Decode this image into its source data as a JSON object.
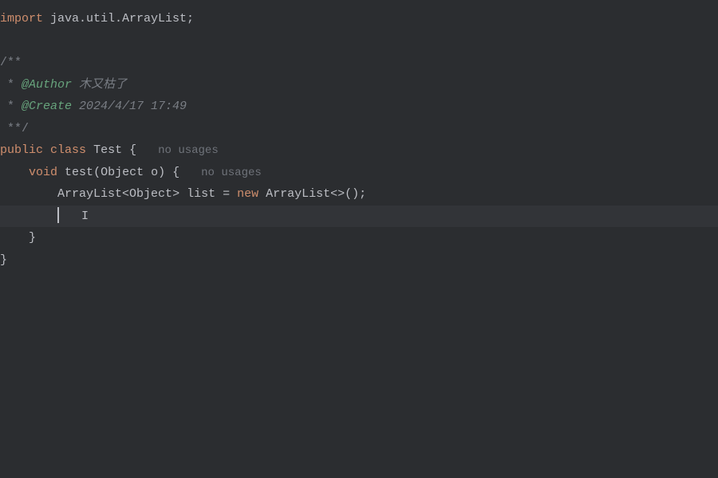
{
  "code": {
    "l1": {
      "import": "import",
      "pkg": " java.util.ArrayList;"
    },
    "l3": {
      "text": "/**"
    },
    "l4": {
      "prefix": " * ",
      "tag": "@Author",
      "value": " 木又枯了"
    },
    "l5": {
      "prefix": " * ",
      "tag": "@Create",
      "value": " 2024/4/17 17:49"
    },
    "l6": {
      "text": " **/"
    },
    "l7": {
      "public": "public",
      "class": "class",
      "name": "Test",
      "brace": " {",
      "hint": "no usages"
    },
    "l8": {
      "indent": "    ",
      "void": "void",
      "method": "test",
      "params_open": "(",
      "param_type": "Object",
      "param_name": " o",
      "params_close": ")",
      "brace": " {",
      "hint": "no usages"
    },
    "l9": {
      "indent": "        ",
      "type1": "ArrayList",
      "lt": "<",
      "gtype": "Object",
      "gt": ">",
      "var": " list",
      "eq": " = ",
      "new": "new",
      "type2": " ArrayList",
      "diamond": "<>",
      "call": "();"
    },
    "l10": {
      "indent": "        "
    },
    "l11": {
      "indent": "    ",
      "brace": "}"
    },
    "l12": {
      "brace": "}"
    }
  }
}
